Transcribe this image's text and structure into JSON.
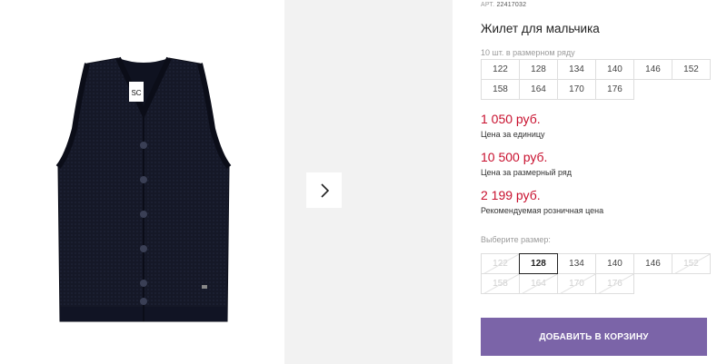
{
  "product": {
    "sku_label": "АРТ.",
    "sku_value": "22417032",
    "title": "Жилет для мальчика",
    "logo_text": "SC"
  },
  "pack": {
    "note": "10 шт. в размерном ряду",
    "sizes": [
      "122",
      "128",
      "134",
      "140",
      "146",
      "152",
      "158",
      "164",
      "170",
      "176"
    ]
  },
  "prices": {
    "unit_price": "1 050 руб.",
    "unit_label": "Цена за единицу",
    "row_price": "10 500 руб.",
    "row_label": "Цена за размерный ряд",
    "retail_price": "2 199 руб.",
    "retail_label": "Рекомендуемая розничная цена"
  },
  "size_picker": {
    "label": "Выберите размер:",
    "options": [
      {
        "size": "122",
        "state": "disabled"
      },
      {
        "size": "128",
        "state": "selected"
      },
      {
        "size": "134",
        "state": "available"
      },
      {
        "size": "140",
        "state": "available"
      },
      {
        "size": "146",
        "state": "available"
      },
      {
        "size": "152",
        "state": "disabled"
      },
      {
        "size": "158",
        "state": "disabled"
      },
      {
        "size": "164",
        "state": "disabled"
      },
      {
        "size": "170",
        "state": "disabled"
      },
      {
        "size": "176",
        "state": "disabled"
      }
    ]
  },
  "actions": {
    "add_to_cart": "ДОБАВИТЬ В КОРЗИНУ"
  },
  "colors": {
    "price": "#c8102e",
    "button": "#7b64a8",
    "gallery_side": "#f2f2f2",
    "vest": "#151827"
  },
  "icons": {
    "next": "chevron-right-icon"
  }
}
